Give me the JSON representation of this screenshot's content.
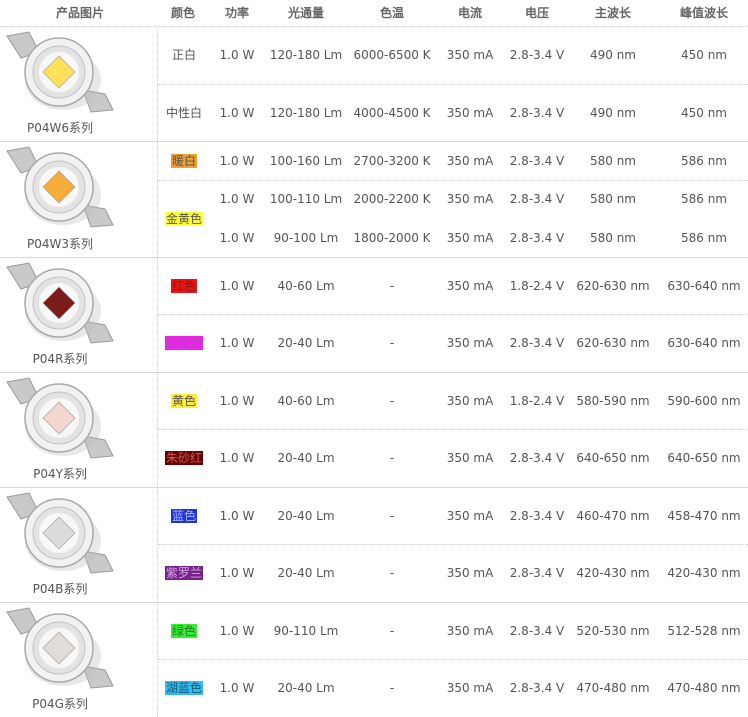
{
  "headers": [
    "产品图片",
    "颜色",
    "功率",
    "光通量",
    "色温",
    "电流",
    "电压",
    "主波长",
    "峰值波长"
  ],
  "groups": [
    {
      "name": "P04W6系列",
      "chip_color": "#ffe15a",
      "rows": [
        {
          "color": "正白",
          "power": "1.0 W",
          "flux": "120-180 Lm",
          "cct": "6000-6500 K",
          "current": "350 mA",
          "voltage": "2.8-3.4 V",
          "dom_wl": "490 nm",
          "peak_wl": "450 nm"
        },
        {
          "color": "中性白",
          "power": "1.0 W",
          "flux": "120-180 Lm",
          "cct": "4000-4500 K",
          "current": "350 mA",
          "voltage": "2.8-3.4 V",
          "dom_wl": "490 nm",
          "peak_wl": "450 nm"
        }
      ]
    },
    {
      "name": "P04W3系列",
      "chip_color": "#f6ae3a",
      "rows": [
        {
          "color": "暖白",
          "color_bg": "#f0a030",
          "color_fg": "#555555",
          "power": "1.0 W",
          "flux": "100-160 Lm",
          "cct": "2700-3200 K",
          "current": "350 mA",
          "voltage": "2.8-3.4 V",
          "dom_wl": "580 nm",
          "peak_wl": "586 nm"
        },
        {
          "color": "金黄色",
          "color_bg": "#ffff33",
          "color_fg": "#555555",
          "power": "1.0 W",
          "flux": "100-110 Lm",
          "cct": "2000-2200 K",
          "current": "350 mA",
          "voltage": "2.8-3.4 V",
          "dom_wl": "580 nm",
          "peak_wl": "586 nm"
        },
        {
          "power": "1.0 W",
          "flux": "90-100 Lm",
          "cct": "1800-2000 K",
          "current": "350 mA",
          "voltage": "2.8-3.4 V",
          "dom_wl": "580 nm",
          "peak_wl": "586 nm"
        }
      ]
    },
    {
      "name": "P04R系列",
      "chip_color": "#7a1c18",
      "rows": [
        {
          "color": "红色",
          "color_bg": "#ee1111",
          "color_fg": "#8a1a1a",
          "power": "1.0 W",
          "flux": "40-60 Lm",
          "cct": "-",
          "current": "350 mA",
          "voltage": "1.8-2.4 V",
          "dom_wl": "620-630 nm",
          "peak_wl": "630-640 nm"
        },
        {
          "color": "粉红色",
          "color_bg": "#ee22ee",
          "color_fg": "#bb44bb",
          "power": "1.0 W",
          "flux": "20-40 Lm",
          "cct": "-",
          "current": "350 mA",
          "voltage": "2.8-3.4 V",
          "dom_wl": "620-630 nm",
          "peak_wl": "630-640 nm"
        }
      ]
    },
    {
      "name": "P04Y系列",
      "chip_color": "#f4d6d0",
      "rows": [
        {
          "color": "黄色",
          "color_bg": "#ffee33",
          "color_fg": "#555555",
          "power": "1.0 W",
          "flux": "40-60 Lm",
          "cct": "-",
          "current": "350 mA",
          "voltage": "1.8-2.4 V",
          "dom_wl": "580-590 nm",
          "peak_wl": "590-600 nm"
        },
        {
          "color": "朱砂红",
          "color_bg": "#660000",
          "color_fg": "#d25555",
          "power": "1.0 W",
          "flux": "20-40 Lm",
          "cct": "-",
          "current": "350 mA",
          "voltage": "2.8-3.4 V",
          "dom_wl": "640-650 nm",
          "peak_wl": "640-650 nm"
        }
      ]
    },
    {
      "name": "P04B系列",
      "chip_color": "#dcdcdc",
      "rows": [
        {
          "color": "蓝色",
          "color_bg": "#2233dd",
          "color_fg": "#a8b4ff",
          "power": "1.0 W",
          "flux": "20-40 Lm",
          "cct": "-",
          "current": "350 mA",
          "voltage": "2.8-3.4 V",
          "dom_wl": "460-470 nm",
          "peak_wl": "458-470 nm"
        },
        {
          "color": "紫罗兰",
          "color_bg": "#772288",
          "color_fg": "#d9a7e8",
          "power": "1.0 W",
          "flux": "20-40 Lm",
          "cct": "-",
          "current": "350 mA",
          "voltage": "2.8-3.4 V",
          "dom_wl": "420-430 nm",
          "peak_wl": "420-430 nm"
        }
      ]
    },
    {
      "name": "P04G系列",
      "chip_color": "#e2dcd8",
      "rows": [
        {
          "color": "绿色",
          "color_bg": "#33ee33",
          "color_fg": "#2a7a2a",
          "power": "1.0 W",
          "flux": "90-110 Lm",
          "cct": "-",
          "current": "350 mA",
          "voltage": "2.8-3.4 V",
          "dom_wl": "520-530 nm",
          "peak_wl": "512-528 nm"
        },
        {
          "color": "湖蓝色",
          "color_bg": "#33bbee",
          "color_fg": "#1a5a7a",
          "power": "1.0 W",
          "flux": "20-40 Lm",
          "cct": "-",
          "current": "350 mA",
          "voltage": "2.8-3.4 V",
          "dom_wl": "470-480 nm",
          "peak_wl": "470-480 nm"
        }
      ]
    }
  ]
}
